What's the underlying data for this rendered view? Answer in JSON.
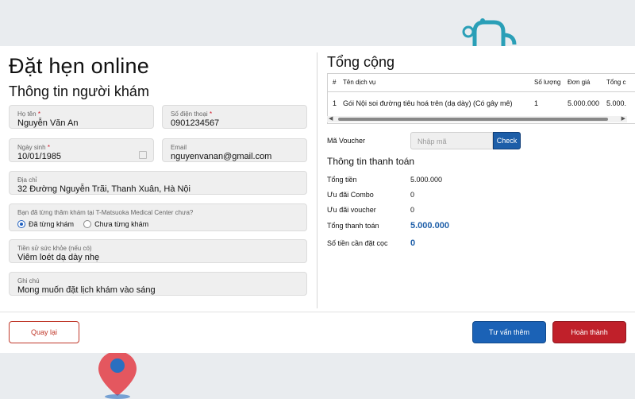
{
  "colors": {
    "primary": "#1b62b6",
    "danger": "#c0202a",
    "panel": "#ffffff",
    "background": "#e9ecef"
  },
  "page": {
    "title": "Đặt hẹn online"
  },
  "patient": {
    "title": "Thông tin người khám",
    "name": {
      "label": "Họ tên",
      "value": "Nguyễn Văn An"
    },
    "phone": {
      "label": "Số điện thoại",
      "value": "0901234567"
    },
    "dob": {
      "label": "Ngày sinh",
      "value": "10/01/1985"
    },
    "email": {
      "label": "Email",
      "value": "nguyenvanan@gmail.com"
    },
    "address": {
      "label": "Địa chỉ",
      "value": "32 Đường Nguyễn Trãi, Thanh Xuân, Hà Nội"
    },
    "visited": {
      "question": "Bạn đã từng thăm khám tại T-Matsuoka Medical Center chưa?",
      "options": [
        "Đã từng khám",
        "Chưa từng khám"
      ],
      "selected": "Đã từng khám"
    },
    "history": {
      "label": "Tiền sử sức khỏe (nếu có)",
      "value": "Viêm loét dạ dày nhẹ"
    },
    "note": {
      "label": "Ghi chú",
      "value": "Mong muốn đặt lịch khám vào sáng"
    }
  },
  "summary": {
    "title": "Tổng cộng",
    "columns": [
      "#",
      "Tên dịch vụ",
      "Số lượng",
      "Đơn giá",
      "Tổng c"
    ],
    "rows": [
      {
        "index": "1",
        "service": "Gói Nội soi đường tiêu hoá trên (dạ dày) (Có gây mê)",
        "qty": "1",
        "price": "5.000.000",
        "total": "5.000."
      }
    ],
    "scroll_left": "◀",
    "scroll_right": "▶"
  },
  "voucher": {
    "label": "Mã Voucher",
    "placeholder": "Nhập mã",
    "button": "Check"
  },
  "payment": {
    "title": "Thông tin thanh toán",
    "rows": [
      {
        "label": "Tổng tiền",
        "value": "5.000.000"
      },
      {
        "label": "Ưu đãi Combo",
        "value": "0"
      },
      {
        "label": "Ưu đãi voucher",
        "value": "0"
      },
      {
        "label": "Tổng thanh toán",
        "value": "5.000.000"
      },
      {
        "label": "Số tiền cần đặt cọc",
        "value": "0"
      }
    ]
  },
  "actions": {
    "back": "Quay lại",
    "consult": "Tư vấn thêm",
    "finish": "Hoàn thành"
  }
}
